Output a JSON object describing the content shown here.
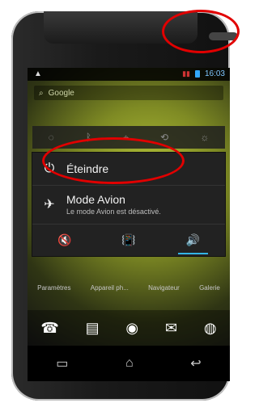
{
  "status": {
    "left_icon": "warning",
    "time": "16:03"
  },
  "search": {
    "placeholder": "Google"
  },
  "quick_settings": {
    "items": [
      "wifi-icon",
      "bluetooth-icon",
      "gps-icon",
      "sync-icon",
      "brightness-icon"
    ]
  },
  "power_menu": {
    "items": [
      {
        "label": "Éteindre",
        "icon": "power-icon"
      },
      {
        "label": "Mode Avion",
        "subtitle": "Le mode Avion est désactivé.",
        "icon": "airplane-icon"
      }
    ],
    "sound_modes": [
      "silent-icon",
      "vibrate-icon",
      "sound-on-icon"
    ],
    "active_sound_mode": "sound-on-icon"
  },
  "dock": {
    "labels": [
      "Paramètres",
      "Appareil ph...",
      "Navigateur",
      "Galerie"
    ]
  },
  "nav": {
    "items": [
      "recent-apps-icon",
      "home-icon",
      "back-icon"
    ]
  },
  "colors": {
    "accent": "#33b5e5",
    "highlight": "#e10000"
  }
}
